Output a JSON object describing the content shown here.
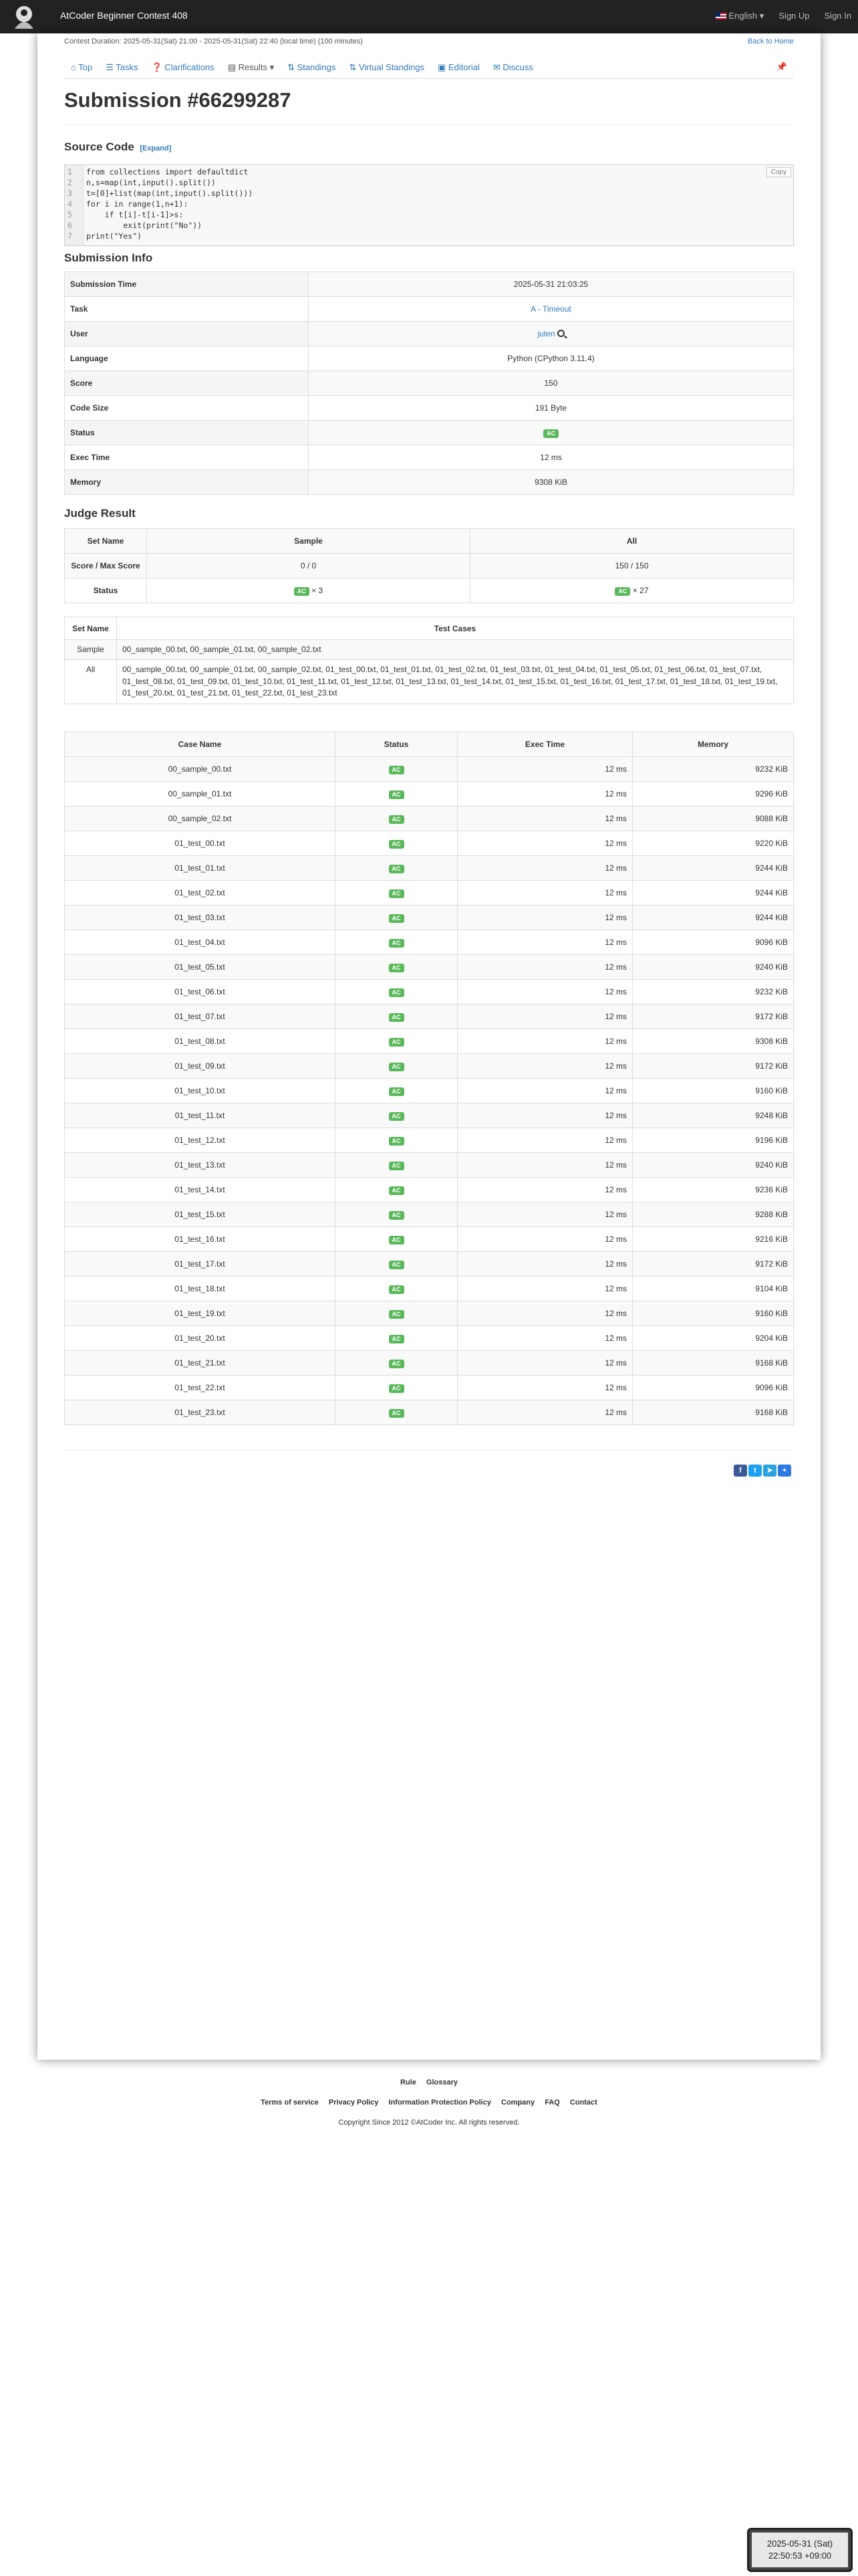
{
  "navbar": {
    "contest_title": "AtCoder Beginner Contest 408",
    "language": "English",
    "sign_up": "Sign Up",
    "sign_in": "Sign In"
  },
  "header": {
    "contest_duration": "Contest Duration: 2025-05-31(Sat) 21:00 - 2025-05-31(Sat) 22:40 (local time) (100 minutes)",
    "back_home": "Back to Home"
  },
  "tabs": [
    {
      "label": "Top",
      "icon": "home-icon"
    },
    {
      "label": "Tasks",
      "icon": "list-icon"
    },
    {
      "label": "Clarifications",
      "icon": "question-icon"
    },
    {
      "label": "Results",
      "icon": "results-icon"
    },
    {
      "label": "Standings",
      "icon": "sort-icon"
    },
    {
      "label": "Virtual Standings",
      "icon": "sort-icon"
    },
    {
      "label": "Editorial",
      "icon": "book-icon"
    },
    {
      "label": "Discuss",
      "icon": "comment-icon"
    }
  ],
  "page_title": "Submission #66299287",
  "source_code": {
    "heading": "Source Code",
    "expand": "[Expand]",
    "copy": "Copy",
    "lines": [
      "from collections import defaultdict",
      "n,s=map(int,input().split())",
      "t=[0]+list(map(int,input().split()))",
      "for i in range(1,n+1):",
      "    if t[i]-t[i-1]>s:",
      "        exit(print(\"No\"))",
      "print(\"Yes\")"
    ]
  },
  "submission_info": {
    "heading": "Submission Info",
    "rows": [
      {
        "key": "Submission Time",
        "value": "2025-05-31 21:03:25"
      },
      {
        "key": "Task",
        "value": "A - Timeout"
      },
      {
        "key": "User",
        "value": "juten"
      },
      {
        "key": "Language",
        "value": "Python (CPython 3.11.4)"
      },
      {
        "key": "Score",
        "value": "150"
      },
      {
        "key": "Code Size",
        "value": "191 Byte"
      },
      {
        "key": "Status",
        "value": "AC"
      },
      {
        "key": "Exec Time",
        "value": "12 ms"
      },
      {
        "key": "Memory",
        "value": "9308 KiB"
      }
    ]
  },
  "judge_result": {
    "heading": "Judge Result",
    "headers": [
      "Set Name",
      "Sample",
      "All"
    ],
    "score_label": "Score / Max Score",
    "sample_score": "0 / 0",
    "all_score": "150 / 150",
    "status_label": "Status",
    "sample_status": "AC",
    "sample_count": "× 3",
    "all_status": "AC",
    "all_count": "× 27"
  },
  "test_sets": {
    "headers": [
      "Set Name",
      "Test Cases"
    ],
    "rows": [
      {
        "name": "Sample",
        "cases": "00_sample_00.txt, 00_sample_01.txt, 00_sample_02.txt"
      },
      {
        "name": "All",
        "cases": "00_sample_00.txt, 00_sample_01.txt, 00_sample_02.txt, 01_test_00.txt, 01_test_01.txt, 01_test_02.txt, 01_test_03.txt, 01_test_04.txt, 01_test_05.txt, 01_test_06.txt, 01_test_07.txt, 01_test_08.txt, 01_test_09.txt, 01_test_10.txt, 01_test_11.txt, 01_test_12.txt, 01_test_13.txt, 01_test_14.txt, 01_test_15.txt, 01_test_16.txt, 01_test_17.txt, 01_test_18.txt, 01_test_19.txt, 01_test_20.txt, 01_test_21.txt, 01_test_22.txt, 01_test_23.txt"
      }
    ]
  },
  "cases": {
    "headers": [
      "Case Name",
      "Status",
      "Exec Time",
      "Memory"
    ],
    "rows": [
      {
        "name": "00_sample_00.txt",
        "status": "AC",
        "time": "12 ms",
        "memory": "9232 KiB"
      },
      {
        "name": "00_sample_01.txt",
        "status": "AC",
        "time": "12 ms",
        "memory": "9296 KiB"
      },
      {
        "name": "00_sample_02.txt",
        "status": "AC",
        "time": "12 ms",
        "memory": "9088 KiB"
      },
      {
        "name": "01_test_00.txt",
        "status": "AC",
        "time": "12 ms",
        "memory": "9220 KiB"
      },
      {
        "name": "01_test_01.txt",
        "status": "AC",
        "time": "12 ms",
        "memory": "9244 KiB"
      },
      {
        "name": "01_test_02.txt",
        "status": "AC",
        "time": "12 ms",
        "memory": "9244 KiB"
      },
      {
        "name": "01_test_03.txt",
        "status": "AC",
        "time": "12 ms",
        "memory": "9244 KiB"
      },
      {
        "name": "01_test_04.txt",
        "status": "AC",
        "time": "12 ms",
        "memory": "9096 KiB"
      },
      {
        "name": "01_test_05.txt",
        "status": "AC",
        "time": "12 ms",
        "memory": "9240 KiB"
      },
      {
        "name": "01_test_06.txt",
        "status": "AC",
        "time": "12 ms",
        "memory": "9232 KiB"
      },
      {
        "name": "01_test_07.txt",
        "status": "AC",
        "time": "12 ms",
        "memory": "9172 KiB"
      },
      {
        "name": "01_test_08.txt",
        "status": "AC",
        "time": "12 ms",
        "memory": "9308 KiB"
      },
      {
        "name": "01_test_09.txt",
        "status": "AC",
        "time": "12 ms",
        "memory": "9172 KiB"
      },
      {
        "name": "01_test_10.txt",
        "status": "AC",
        "time": "12 ms",
        "memory": "9160 KiB"
      },
      {
        "name": "01_test_11.txt",
        "status": "AC",
        "time": "12 ms",
        "memory": "9248 KiB"
      },
      {
        "name": "01_test_12.txt",
        "status": "AC",
        "time": "12 ms",
        "memory": "9196 KiB"
      },
      {
        "name": "01_test_13.txt",
        "status": "AC",
        "time": "12 ms",
        "memory": "9240 KiB"
      },
      {
        "name": "01_test_14.txt",
        "status": "AC",
        "time": "12 ms",
        "memory": "9236 KiB"
      },
      {
        "name": "01_test_15.txt",
        "status": "AC",
        "time": "12 ms",
        "memory": "9288 KiB"
      },
      {
        "name": "01_test_16.txt",
        "status": "AC",
        "time": "12 ms",
        "memory": "9216 KiB"
      },
      {
        "name": "01_test_17.txt",
        "status": "AC",
        "time": "12 ms",
        "memory": "9172 KiB"
      },
      {
        "name": "01_test_18.txt",
        "status": "AC",
        "time": "12 ms",
        "memory": "9104 KiB"
      },
      {
        "name": "01_test_19.txt",
        "status": "AC",
        "time": "12 ms",
        "memory": "9160 KiB"
      },
      {
        "name": "01_test_20.txt",
        "status": "AC",
        "time": "12 ms",
        "memory": "9204 KiB"
      },
      {
        "name": "01_test_21.txt",
        "status": "AC",
        "time": "12 ms",
        "memory": "9168 KiB"
      },
      {
        "name": "01_test_22.txt",
        "status": "AC",
        "time": "12 ms",
        "memory": "9096 KiB"
      },
      {
        "name": "01_test_23.txt",
        "status": "AC",
        "time": "12 ms",
        "memory": "9168 KiB"
      }
    ]
  },
  "footer": {
    "links_row1": [
      "Rule",
      "Glossary"
    ],
    "links_row2": [
      "Terms of service",
      "Privacy Policy",
      "Information Protection Policy",
      "Company",
      "FAQ",
      "Contact"
    ],
    "copyright": "Copyright Since 2012 ©AtCoder Inc. All rights reserved."
  },
  "clock": {
    "date": "2025-05-31 (Sat)",
    "time": "22:50:53 +09:00"
  },
  "colors": {
    "accent": "#337ab7",
    "ac_green": "#5cb85c",
    "navbar": "#222222"
  }
}
